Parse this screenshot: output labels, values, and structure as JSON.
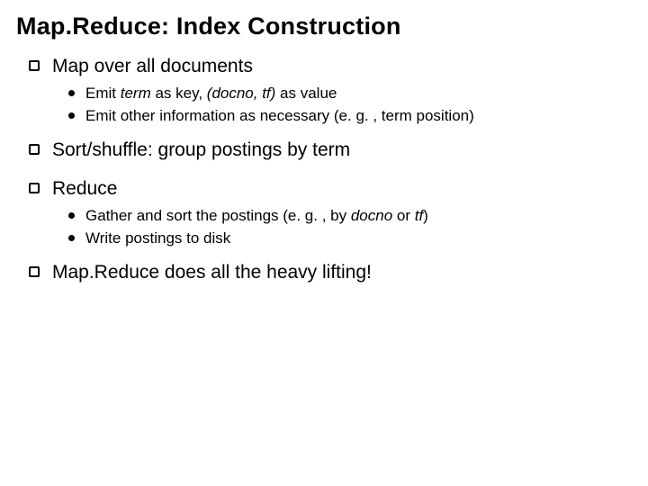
{
  "title": "Map.Reduce: Index Construction",
  "items": [
    {
      "text": "Map over all documents",
      "sub": [
        {
          "pre": "Emit ",
          "it1": "term",
          "mid1": " as key, ",
          "it2": "(docno, tf)",
          "mid2": " as value",
          "post": ""
        },
        {
          "pre": "Emit other information as necessary (e. g. , term position)",
          "it1": "",
          "mid1": "",
          "it2": "",
          "mid2": "",
          "post": ""
        }
      ]
    },
    {
      "text": "Sort/shuffle: group postings by term",
      "sub": []
    },
    {
      "text": "Reduce",
      "sub": [
        {
          "pre": "Gather and sort the postings (e. g. , by ",
          "it1": "docno",
          "mid1": " or ",
          "it2": "tf",
          "mid2": ")",
          "post": ""
        },
        {
          "pre": "Write postings to disk",
          "it1": "",
          "mid1": "",
          "it2": "",
          "mid2": "",
          "post": ""
        }
      ]
    },
    {
      "text": "Map.Reduce does all the heavy lifting!",
      "sub": []
    }
  ]
}
